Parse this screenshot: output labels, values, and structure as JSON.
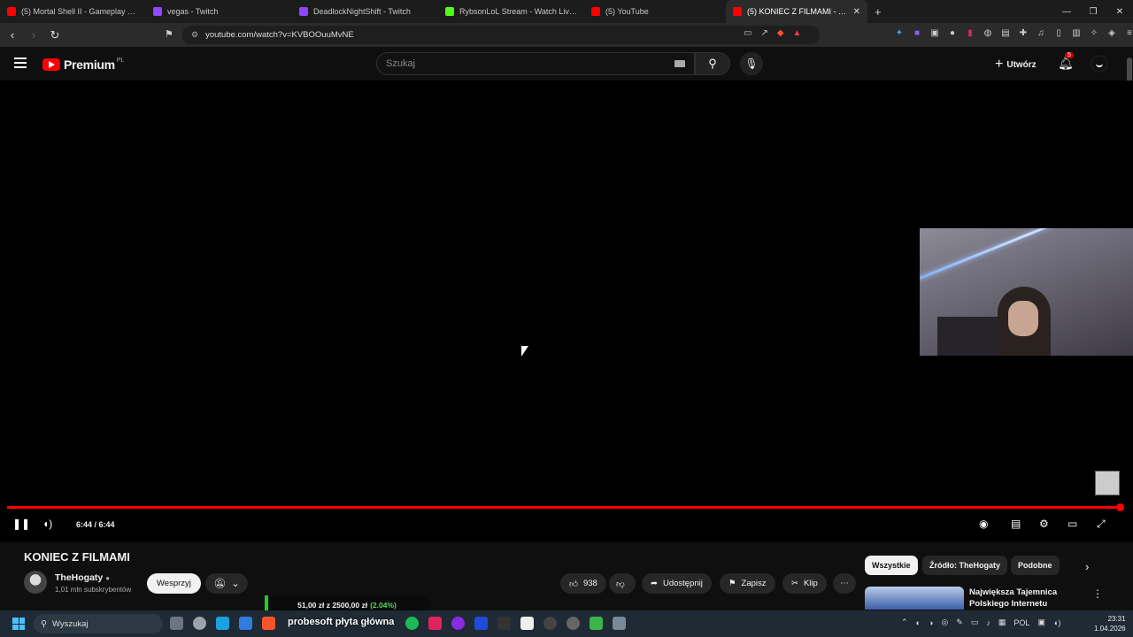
{
  "browser": {
    "tabs": [
      {
        "title": "(5) Mortal Shell II - Gameplay Reveal",
        "color": "#ff0000",
        "active": false
      },
      {
        "title": "vegas - Twitch",
        "color": "#9146ff",
        "active": false
      },
      {
        "title": "DeadlockNightShift - Twitch",
        "color": "#9146ff",
        "active": false
      },
      {
        "title": "RybsonLoL Stream - Watch Live o",
        "color": "#53fc18",
        "active": false
      },
      {
        "title": "(5) YouTube",
        "color": "#ff0000",
        "active": false
      },
      {
        "title": "(5) KONIEC Z FILMAMI - YouTube",
        "color": "#ff0000",
        "active": true
      }
    ],
    "url": "youtube.com/watch?v=KVBOOuuMvNE"
  },
  "yt": {
    "logo_text": "Premium",
    "logo_country": "PL",
    "search_placeholder": "Szukaj",
    "create_label": "Utwórz",
    "notification_count": "5"
  },
  "player": {
    "time": "6:44 / 6:44",
    "progress": 1.0
  },
  "video": {
    "title": "KONIEC Z FILMAMI",
    "channel_name": "TheHogaty",
    "subscribers": "1,01 mln subskrybentów",
    "support_label": "Wesprzyj",
    "likes": "938",
    "share_label": "Udostępnij",
    "save_label": "Zapisz",
    "clip_label": "Klip"
  },
  "donation": {
    "amount": "51,00 zł",
    "connector": "z",
    "goal": "2500,00 zł",
    "percent": "(2.04%)"
  },
  "sidebar": {
    "chips": [
      "Wszystkie",
      "Źródło: TheHogaty",
      "Podobne"
    ],
    "rec_title": "Największa Tajemnica Polskiego Internetu"
  },
  "taskbar": {
    "search_label": "Wyszukaj",
    "stream_label": "probesoft płyta główna",
    "language": "POL",
    "time": "23:31",
    "date": "1.04.2026"
  }
}
